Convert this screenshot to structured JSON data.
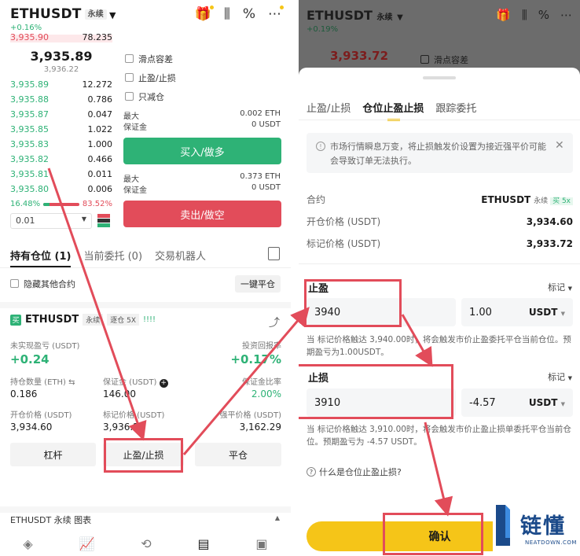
{
  "left": {
    "header": {
      "symbol": "ETHUSDT",
      "perp_tag": "永续",
      "change": "+0.16%"
    },
    "orderbook": {
      "ask_partial": {
        "price": "3,935.90",
        "qty": "78.235"
      },
      "mid_price": "3,935.89",
      "mark_price": "3,936.22",
      "bids": [
        {
          "price": "3,935.89",
          "qty": "12.272"
        },
        {
          "price": "3,935.88",
          "qty": "0.786"
        },
        {
          "price": "3,935.87",
          "qty": "0.047"
        },
        {
          "price": "3,935.85",
          "qty": "1.022"
        },
        {
          "price": "3,935.83",
          "qty": "1.000"
        },
        {
          "price": "3,935.82",
          "qty": "0.466"
        },
        {
          "price": "3,935.81",
          "qty": "0.011"
        },
        {
          "price": "3,935.80",
          "qty": "0.006"
        }
      ],
      "buy_ratio": "16.48%",
      "sell_ratio": "83.52%",
      "buy_ratio_value": 16.48,
      "depth": "0.01"
    },
    "order_form": {
      "options": [
        "滑点容差",
        "止盈/止损",
        "只减仓"
      ],
      "buy_max_label": "最大",
      "buy_max_value": "0.002 ETH",
      "buy_margin_label": "保证金",
      "buy_margin_value": "0 USDT",
      "buy_button": "买入/做多",
      "sell_max_label": "最大",
      "sell_max_value": "0.373 ETH",
      "sell_margin_label": "保证金",
      "sell_margin_value": "0 USDT",
      "sell_button": "卖出/做空"
    },
    "tabs": [
      "持有仓位 (1)",
      "当前委托 (0)",
      "交易机器人"
    ],
    "hide_other": "隐藏其他合约",
    "close_all": "一键平仓",
    "position": {
      "side_badge": "买",
      "symbol": "ETHUSDT",
      "perp_tag": "永续",
      "margin_tag": "逐仓 5X",
      "bars": "!!!!",
      "unrealized_label": "未实现盈亏 (USDT)",
      "unrealized_value": "+0.24",
      "roi_label": "投资回报率",
      "roi_value": "+0.17%",
      "qty_label": "持仓数量 (ETH) ⇆",
      "qty_value": "0.186",
      "margin_label": "保证金 (USDT)",
      "margin_value": "146.00",
      "margin_ratio_label": "保证金比率",
      "margin_ratio_value": "2.00%",
      "entry_label": "开仓价格 (USDT)",
      "entry_value": "3,934.60",
      "mark_label": "标记价格 (USDT)",
      "mark_value": "3,936.22",
      "liq_label": "强平价格 (USDT)",
      "liq_value": "3,162.29",
      "buttons": [
        "杠杆",
        "止盈/止损",
        "平仓"
      ]
    },
    "chart_link": "ETHUSDT 永续  图表"
  },
  "right": {
    "dim_header": {
      "symbol": "ETHUSDT",
      "perp_tag": "永续",
      "change": "+0.19%",
      "price": "3,933.72",
      "option": "滑点容差"
    },
    "tabs": [
      "止盈/止损",
      "仓位止盈止损",
      "跟踪委托"
    ],
    "notice": "市场行情瞬息万变，将止损触发价设置为接近强平价可能会导致订单无法执行。",
    "contract_label": "合约",
    "contract_value": "ETHUSDT",
    "contract_perp": "永续",
    "contract_badge": "买 5x",
    "entry_label": "开仓价格 (USDT)",
    "entry_value": "3,934.60",
    "mark_label": "标记价格 (USDT)",
    "mark_value": "3,933.72",
    "tp": {
      "label": "止盈",
      "trigger_type": "标记",
      "price": "3940",
      "amount": "1.00",
      "unit": "USDT",
      "hint": "当 标记价格触达 3,940.00时，将会触发市价止盈委托平仓当前仓位。预期盈亏为1.00USDT。"
    },
    "sl": {
      "label": "止损",
      "trigger_type": "标记",
      "price": "3910",
      "amount": "-4.57",
      "unit": "USDT",
      "hint": "当 标记价格触达 3,910.00时，将会触发市价止盈止损单委托平仓当前仓位。预期盈亏为 -4.57 USDT。"
    },
    "faq": "什么是仓位止盈止损?",
    "confirm": "确认"
  },
  "watermark": {
    "text": "链懂",
    "sub": "NEATDOWN.COM"
  },
  "colors": {
    "green": "#2eb276",
    "red": "#e24c5a",
    "yellow": "#f5c518",
    "annotation": "#e24c5a"
  }
}
